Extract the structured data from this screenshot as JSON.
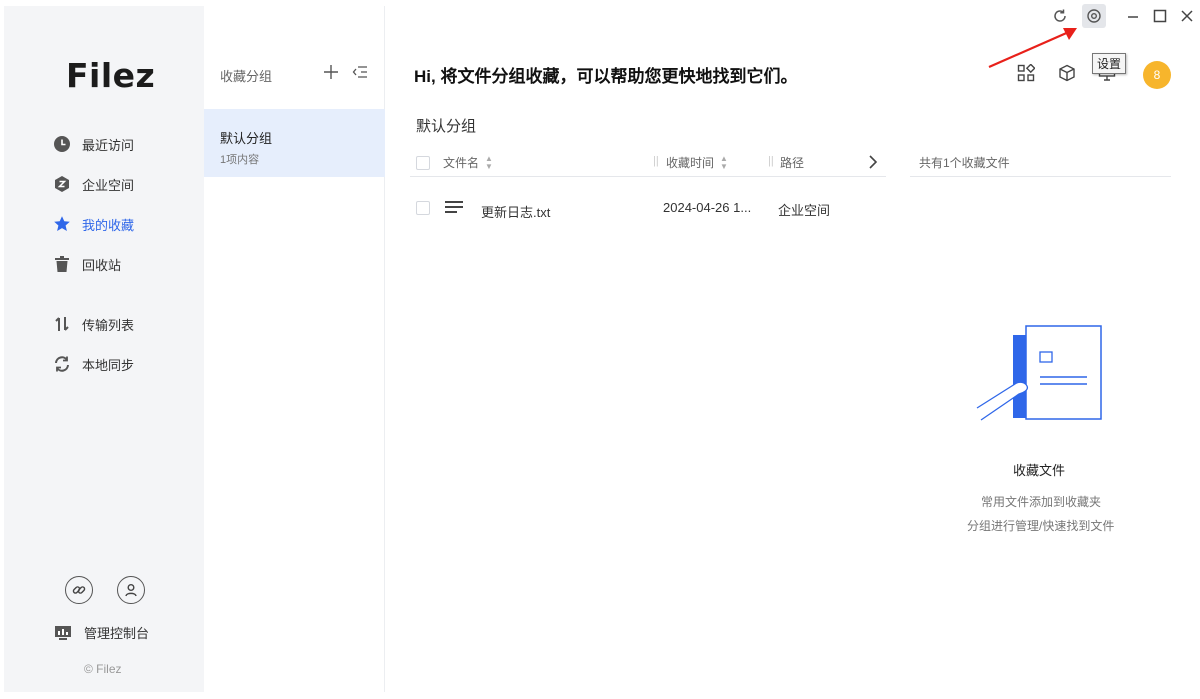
{
  "app": {
    "logo": "Filez",
    "copyright": "© Filez"
  },
  "sidebar": {
    "items": [
      {
        "label": "最近访问",
        "icon": "clock-icon"
      },
      {
        "label": "企业空间",
        "icon": "enterprise-icon"
      },
      {
        "label": "我的收藏",
        "icon": "star-icon",
        "active": true
      },
      {
        "label": "回收站",
        "icon": "trash-icon"
      },
      {
        "label": "传输列表",
        "icon": "transfer-icon"
      },
      {
        "label": "本地同步",
        "icon": "sync-icon"
      }
    ],
    "admin_label": "管理控制台"
  },
  "groups_panel": {
    "title": "收藏分组",
    "items": [
      {
        "name": "默认分组",
        "count": "1项内容"
      }
    ]
  },
  "main": {
    "headline": "Hi, 将文件分组收藏，可以帮助您更快地找到它们。",
    "tooltip": "设置",
    "avatar_text": "8",
    "section_title": "默认分组",
    "columns": {
      "name": "文件名",
      "time": "收藏时间",
      "path": "路径"
    },
    "count_text": "共有1个收藏文件",
    "rows": [
      {
        "name": "更新日志.txt",
        "time": "2024-04-26 1...",
        "path": "企业空间"
      }
    ],
    "empty": {
      "title": "收藏文件",
      "desc1": "常用文件添加到收藏夹",
      "desc2": "分组进行管理/快速找到文件"
    }
  },
  "colors": {
    "accent": "#2f67e9",
    "avatar": "#f7b52c",
    "arrow": "#e8201a"
  }
}
